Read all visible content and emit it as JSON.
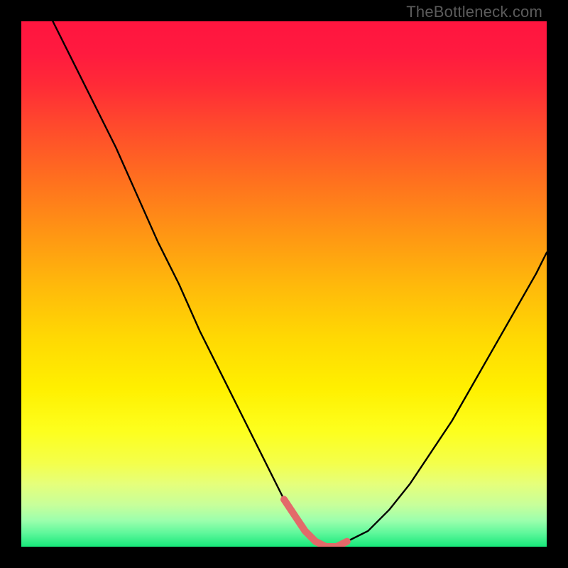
{
  "watermark": "TheBottleneck.com",
  "gradient_stops": [
    {
      "offset": 0.0,
      "color": "#ff153f"
    },
    {
      "offset": 0.06,
      "color": "#ff1a3f"
    },
    {
      "offset": 0.12,
      "color": "#ff2a37"
    },
    {
      "offset": 0.2,
      "color": "#ff4a2c"
    },
    {
      "offset": 0.3,
      "color": "#ff6f1f"
    },
    {
      "offset": 0.4,
      "color": "#ff9414"
    },
    {
      "offset": 0.5,
      "color": "#ffb80b"
    },
    {
      "offset": 0.6,
      "color": "#ffd803"
    },
    {
      "offset": 0.7,
      "color": "#fff000"
    },
    {
      "offset": 0.78,
      "color": "#fdff1e"
    },
    {
      "offset": 0.84,
      "color": "#f4ff4a"
    },
    {
      "offset": 0.88,
      "color": "#e6ff7a"
    },
    {
      "offset": 0.92,
      "color": "#c8ff9a"
    },
    {
      "offset": 0.95,
      "color": "#9cffad"
    },
    {
      "offset": 0.975,
      "color": "#5cf79a"
    },
    {
      "offset": 1.0,
      "color": "#17e87a"
    }
  ],
  "curve_color_black": "#000000",
  "curve_color_accent": "#e36a6a",
  "curve_width_black": 2.4,
  "curve_width_accent": 10,
  "chart_data": {
    "type": "line",
    "title": "",
    "xlabel": "",
    "ylabel": "",
    "xlim": [
      0,
      100
    ],
    "ylim": [
      0,
      100
    ],
    "grid": false,
    "legend": false,
    "series": [
      {
        "name": "bottleneck-curve",
        "x": [
          6,
          10,
          14,
          18,
          22,
          26,
          30,
          34,
          38,
          42,
          46,
          50,
          52,
          54,
          56,
          58,
          60,
          62,
          66,
          70,
          74,
          78,
          82,
          86,
          90,
          94,
          98,
          100
        ],
        "y": [
          100,
          92,
          84,
          76,
          67,
          58,
          50,
          41,
          33,
          25,
          17,
          9,
          6,
          3,
          1,
          0,
          0,
          1,
          3,
          7,
          12,
          18,
          24,
          31,
          38,
          45,
          52,
          56
        ]
      },
      {
        "name": "optimal-zone",
        "x": [
          50,
          52,
          54,
          56,
          58,
          60,
          62
        ],
        "y": [
          9,
          6,
          3,
          1,
          0,
          0,
          1
        ]
      }
    ],
    "annotations": []
  }
}
